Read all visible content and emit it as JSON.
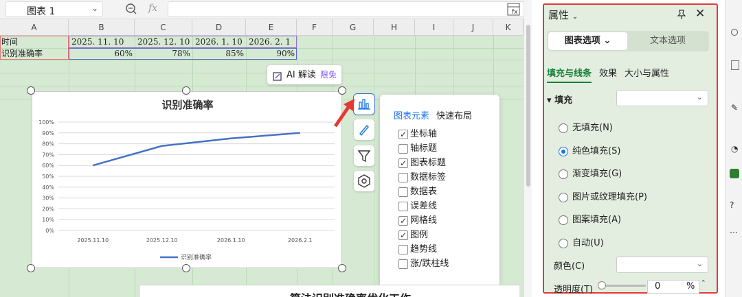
{
  "name_box": {
    "value": "图表 1"
  },
  "formula_bar": {
    "fx_label": "fx",
    "value": ""
  },
  "columns": [
    "A",
    "B",
    "C",
    "D",
    "E",
    "F",
    "G",
    "H",
    "I",
    "J",
    "K"
  ],
  "sheet_rows": {
    "row1": [
      "时间",
      "2025. 11. 10",
      "2025. 12. 10",
      "2026. 1. 10",
      "2026. 2. 1"
    ],
    "row2": [
      "识别准确率",
      "60%",
      "78%",
      "85%",
      "90%"
    ]
  },
  "ai_button": {
    "label": "AI 解读",
    "badge": "限免"
  },
  "side_tools": [
    "chart-elements-icon",
    "chart-style-icon",
    "chart-filter-icon",
    "chart-settings-icon"
  ],
  "chart_popup": {
    "tabs": [
      "图表元素",
      "快速布局"
    ],
    "active_tab": "图表元素",
    "items": [
      {
        "label": "坐标轴",
        "checked": true
      },
      {
        "label": "轴标题",
        "checked": false
      },
      {
        "label": "图表标题",
        "checked": true
      },
      {
        "label": "数据标签",
        "checked": false
      },
      {
        "label": "数据表",
        "checked": false
      },
      {
        "label": "误差线",
        "checked": false
      },
      {
        "label": "网格线",
        "checked": true
      },
      {
        "label": "图例",
        "checked": true
      },
      {
        "label": "趋势线",
        "checked": false
      },
      {
        "label": "涨/跌柱线",
        "checked": false
      }
    ]
  },
  "doc_text": "算法识别准确率优化工作",
  "panel": {
    "title": "属性",
    "seg_a": "图表选项",
    "seg_b": "文本选项",
    "subtabs": [
      "填充与线条",
      "效果",
      "大小与属性"
    ],
    "fill_label": "填充",
    "options": [
      {
        "label": "无填充(N)",
        "selected": false
      },
      {
        "label": "纯色填充(S)",
        "selected": true
      },
      {
        "label": "渐变填充(G)",
        "selected": false
      },
      {
        "label": "图片或纹理填充(P)",
        "selected": false
      },
      {
        "label": "图案填充(A)",
        "selected": false
      },
      {
        "label": "自动(U)",
        "selected": false
      }
    ],
    "color_label": "颜色(C)",
    "transparency_label": "透明度(T)",
    "transparency_value": "0",
    "transparency_unit": "%"
  },
  "colors": {
    "line": "#4472c4",
    "panel_border": "#e53935",
    "accent": "#1a73e8",
    "sheet_bg": "#d6ead3"
  },
  "chart_data": {
    "type": "line",
    "title": "识别准确率",
    "categories": [
      "2025.11.10",
      "2025.12.10",
      "2026.1.10",
      "2026.2.1"
    ],
    "series": [
      {
        "name": "识别准确率",
        "values": [
          60,
          78,
          85,
          90
        ]
      }
    ],
    "y_ticks": [
      "0%",
      "10%",
      "20%",
      "30%",
      "40%",
      "50%",
      "60%",
      "70%",
      "80%",
      "90%",
      "100%"
    ],
    "ylim": [
      0,
      100
    ],
    "grid": true,
    "legend": "bottom"
  }
}
